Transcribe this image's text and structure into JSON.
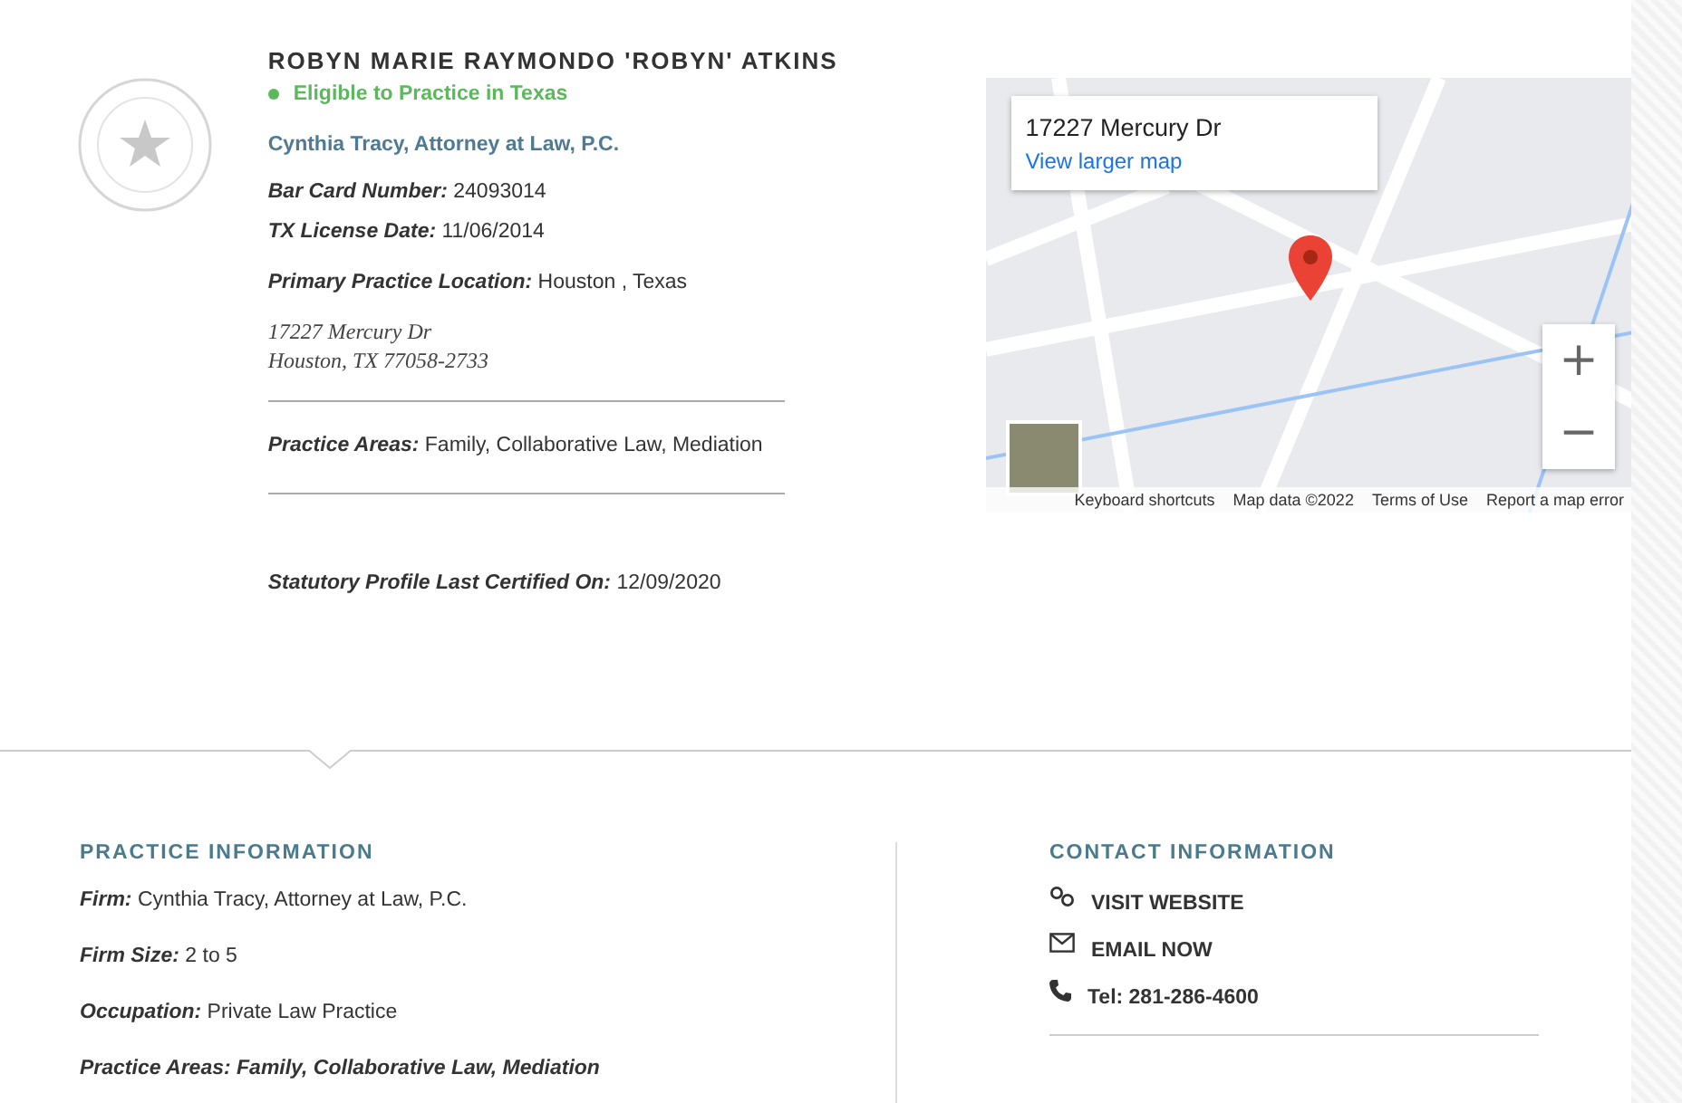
{
  "attorney": {
    "name": "ROBYN MARIE RAYMONDO 'ROBYN' ATKINS",
    "status": {
      "label": "Eligible to Practice in Texas",
      "eligible": true
    },
    "firm": "Cynthia Tracy, Attorney at Law, P.C.",
    "license": [
      {
        "label": "Bar Card Number:",
        "value": "24093014"
      },
      {
        "label": "TX License Date:",
        "value": "11/06/2014"
      }
    ],
    "location": {
      "label": "Primary Practice Location:",
      "value": "Houston , Texas"
    },
    "address": [
      "17227 Mercury Dr",
      "Houston, TX 77058-2733"
    ],
    "practice_areas": {
      "label": "Practice Areas:",
      "value": "Family, Collaborative Law, Mediation"
    },
    "certified": {
      "label": "Statutory Profile Last Certified On:",
      "value": "12/09/2020"
    }
  },
  "map": {
    "card_title": "17227 Mercury Dr",
    "card_link": "View larger map",
    "zoom_in": "+",
    "zoom_out": "−",
    "footer": [
      "Keyboard shortcuts",
      "Map data ©2022",
      "Terms of Use",
      "Report a map error"
    ]
  },
  "practice_information": {
    "title": "PRACTICE INFORMATION",
    "items": [
      {
        "label": "Firm:",
        "value": "Cynthia Tracy, Attorney at Law, P.C.",
        "kind": "plain"
      },
      {
        "label": "Firm Size:",
        "value": "2 to 5",
        "kind": "plain"
      },
      {
        "label": "Occupation:",
        "value": "Private Law Practice",
        "kind": "plain"
      },
      {
        "label": "Practice Areas:",
        "value": "Family, Collaborative Law, Mediation",
        "kind": "emphasis"
      }
    ]
  },
  "contact_information": {
    "title": "CONTACT INFORMATION",
    "items": [
      {
        "kind": "website",
        "label": "VISIT WEBSITE"
      },
      {
        "kind": "email",
        "label": "EMAIL NOW"
      },
      {
        "kind": "phone",
        "label": "Tel: 281-286-4600"
      }
    ]
  }
}
